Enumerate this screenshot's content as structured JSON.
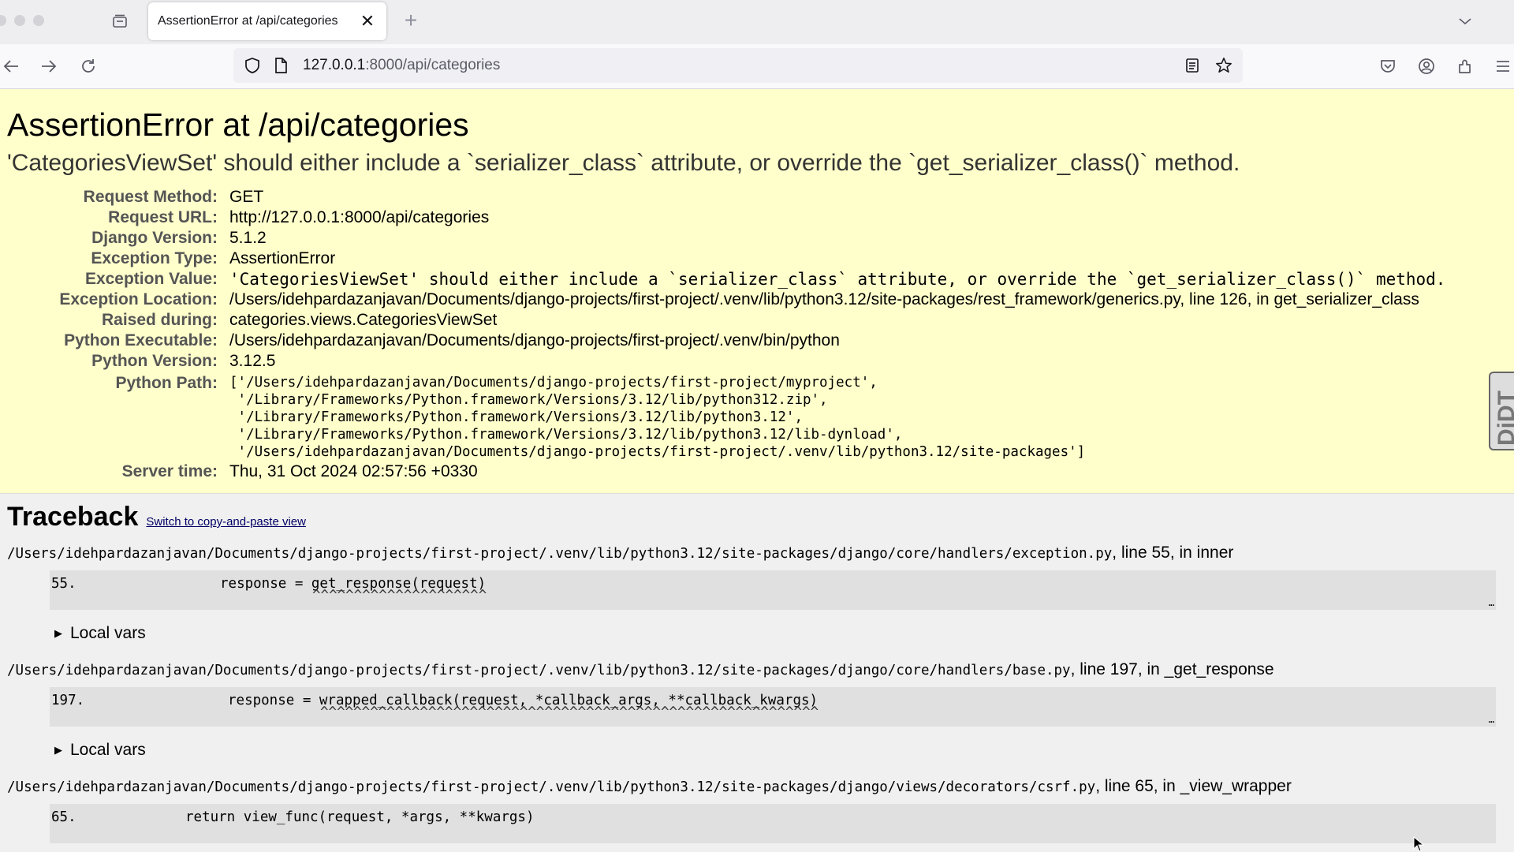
{
  "browser": {
    "tab_title": "AssertionError at /api/categories",
    "tab_close_glyph": "✕",
    "new_tab_glyph": "+",
    "url_host": "127.0.0.1",
    "url_rest": ":8000/api/categories"
  },
  "page": {
    "title": "AssertionError at /api/categories",
    "exception_value_heading": "'CategoriesViewSet' should either include a `serializer_class` attribute, or override the `get_serializer_class()` method.",
    "meta": {
      "request_method_label": "Request Method:",
      "request_method": "GET",
      "request_url_label": "Request URL:",
      "request_url": "http://127.0.0.1:8000/api/categories",
      "django_version_label": "Django Version:",
      "django_version": "5.1.2",
      "exception_type_label": "Exception Type:",
      "exception_type": "AssertionError",
      "exception_value_label": "Exception Value:",
      "exception_value": "'CategoriesViewSet' should either include a `serializer_class` attribute, or override the `get_serializer_class()` method.",
      "exception_location_label": "Exception Location:",
      "exception_location": "/Users/idehpardazanjavan/Documents/django-projects/first-project/.venv/lib/python3.12/site-packages/rest_framework/generics.py, line 126, in get_serializer_class",
      "raised_during_label": "Raised during:",
      "raised_during": "categories.views.CategoriesViewSet",
      "python_executable_label": "Python Executable:",
      "python_executable": "/Users/idehpardazanjavan/Documents/django-projects/first-project/.venv/bin/python",
      "python_version_label": "Python Version:",
      "python_version": "3.12.5",
      "python_path_label": "Python Path:",
      "python_path": [
        "['/Users/idehpardazanjavan/Documents/django-projects/first-project/myproject',",
        " '/Library/Frameworks/Python.framework/Versions/3.12/lib/python312.zip',",
        " '/Library/Frameworks/Python.framework/Versions/3.12/lib/python3.12',",
        " '/Library/Frameworks/Python.framework/Versions/3.12/lib/python3.12/lib-dynload',",
        " '/Users/idehpardazanjavan/Documents/django-projects/first-project/.venv/lib/python3.12/site-packages']"
      ],
      "server_time_label": "Server time:",
      "server_time": "Thu, 31 Oct 2024 02:57:56 +0330"
    },
    "djdt_label": "DjDT"
  },
  "traceback": {
    "heading": "Traceback",
    "switch_link": "Switch to copy-and-paste view",
    "local_vars_label": "Local vars",
    "frames": [
      {
        "path": "/Users/idehpardazanjavan/Documents/django-projects/first-project/.venv/lib/python3.12/site-packages/django/core/handlers/exception.py",
        "suffix": ", line 55, in inner",
        "line_no": "55.",
        "code": "response = get_response(request)",
        "carets": "^^^^^^^^^^^^^^^^^^^^^",
        "ellipsis": "…"
      },
      {
        "path": "/Users/idehpardazanjavan/Documents/django-projects/first-project/.venv/lib/python3.12/site-packages/django/core/handlers/base.py",
        "suffix": ", line 197, in _get_response",
        "line_no": "197.",
        "code": "response = wrapped_callback(request, *callback_args, **callback_kwargs)",
        "carets": "^^^^^^^^^^^^^^^^^^^^^^^^^^^^^^^^^^^^^^^^^^^^^^^^^^^^^^^^^^^^",
        "ellipsis": "…"
      },
      {
        "path": "/Users/idehpardazanjavan/Documents/django-projects/first-project/.venv/lib/python3.12/site-packages/django/views/decorators/csrf.py",
        "suffix": ", line 65, in _view_wrapper",
        "line_no": "65.",
        "code": "return view_func(request, *args, **kwargs)"
      }
    ]
  }
}
